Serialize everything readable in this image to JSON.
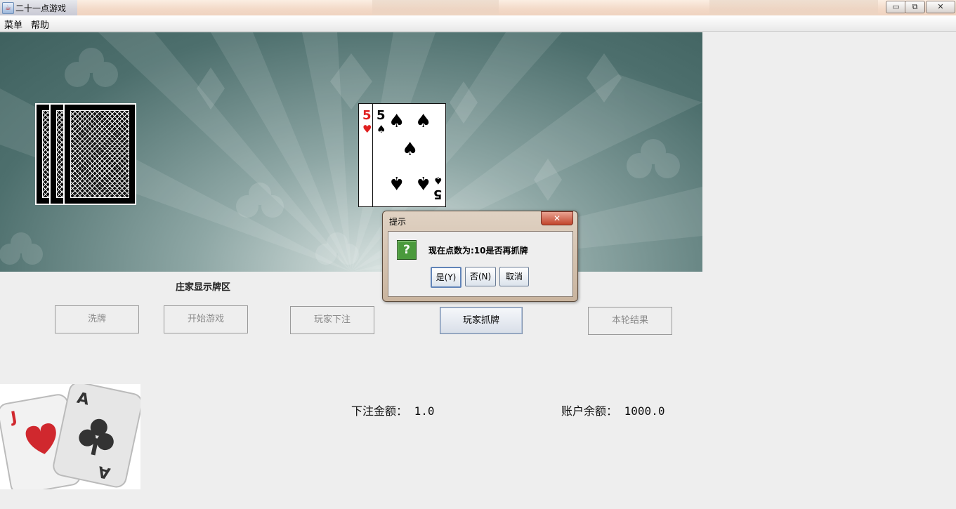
{
  "window": {
    "title": "二十一点游戏",
    "controls": {
      "minimize": "▭",
      "maximize": "⧉",
      "close": "✕"
    }
  },
  "menu": [
    "菜单",
    "帮助"
  ],
  "table": {
    "dealer_cards": [
      "card-back",
      "card-back",
      "card-back"
    ],
    "player_cards": [
      {
        "rank": "5",
        "suit": "hearts",
        "suit_glyph": "♥",
        "color": "#e02020"
      },
      {
        "rank": "5",
        "suit": "spades",
        "suit_glyph": "♠",
        "color": "#000000"
      }
    ]
  },
  "dealer_area_label": "庄家显示牌区",
  "buttons": {
    "shuffle": "洗牌",
    "start": "开始游戏",
    "bet": "玩家下注",
    "draw": "玩家抓牌",
    "result": "本轮结果"
  },
  "dialog": {
    "title": "提示",
    "close": "✕",
    "icon": "question-icon",
    "icon_glyph": "?",
    "message": "现在点数为:10是否再抓牌",
    "yes": "是(Y)",
    "no": "否(N)",
    "cancel": "取消"
  },
  "bet": {
    "label": "下注金额：",
    "value": "1.0"
  },
  "balance": {
    "label": "账户余额：",
    "value": "1000.0"
  },
  "logo": {
    "card1_rank": "J",
    "card2_rank": "A",
    "colors": {
      "red": "#d0282e",
      "dark": "#333333"
    }
  }
}
